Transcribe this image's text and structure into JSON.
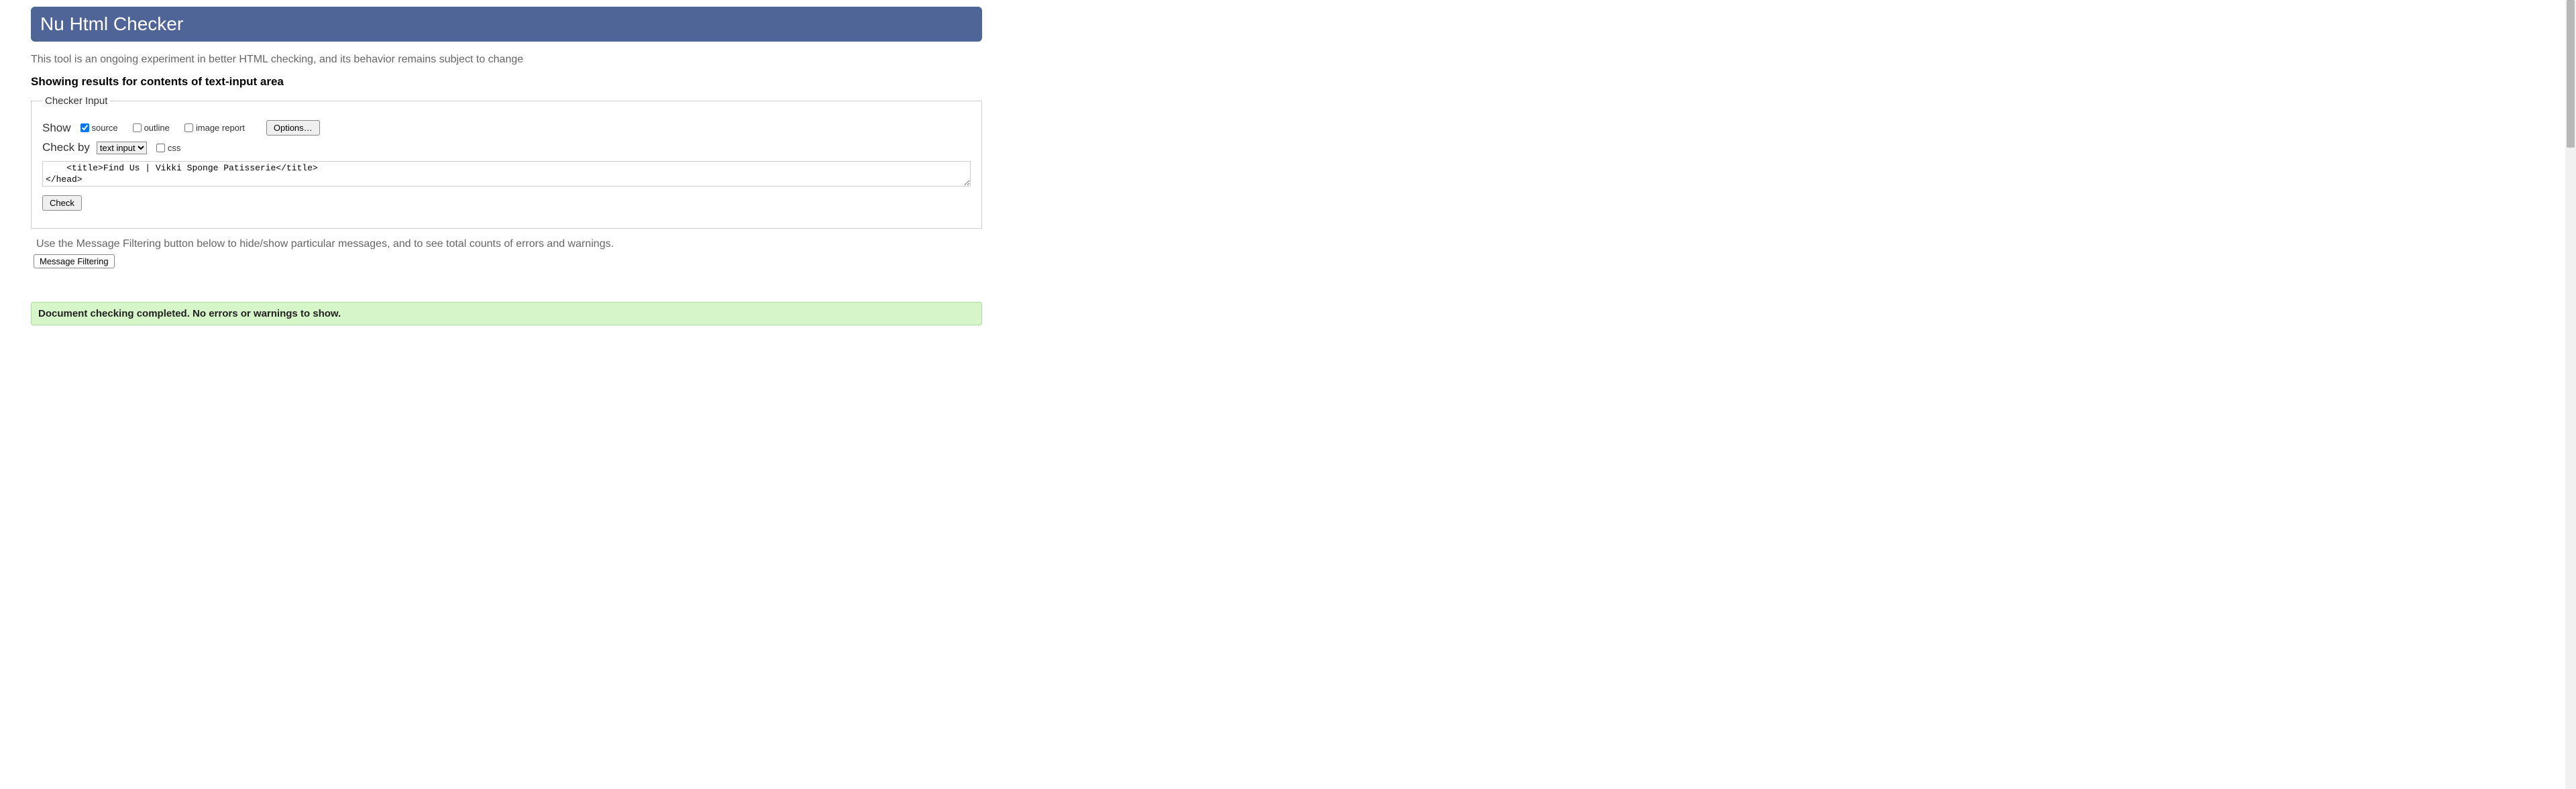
{
  "header": {
    "title": "Nu Html Checker"
  },
  "subtitle": "This tool is an ongoing experiment in better HTML checking, and its behavior remains subject to change",
  "results_heading": "Showing results for contents of text-input area",
  "checker": {
    "legend": "Checker Input",
    "show_label": "Show",
    "source_label": "source",
    "outline_label": "outline",
    "image_report_label": "image report",
    "options_button": "Options…",
    "check_by_label": "Check by",
    "check_by_value": "text input",
    "css_label": "css",
    "textarea_value": "    <title>Find Us | Vikki Sponge Patisserie</title>\n</head>",
    "check_button": "Check"
  },
  "filter": {
    "hint": "Use the Message Filtering button below to hide/show particular messages, and to see total counts of errors and warnings.",
    "button": "Message Filtering"
  },
  "result_banner": "Document checking completed. No errors or warnings to show."
}
